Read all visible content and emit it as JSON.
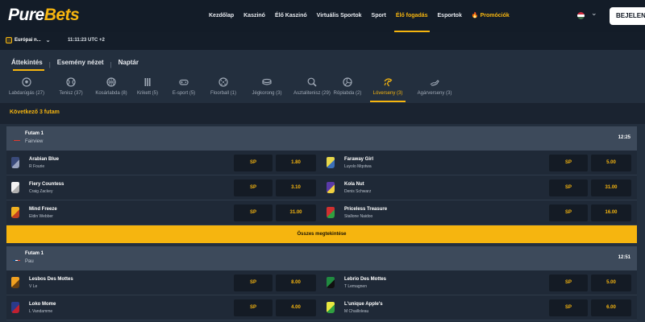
{
  "brand": {
    "logo_main": "Pure",
    "logo_accent": "Bets"
  },
  "nav": {
    "items": [
      {
        "label": "Kezdőlap"
      },
      {
        "label": "Kaszinó"
      },
      {
        "label": "Élő Kaszinó"
      },
      {
        "label": "Virtuális Sportok"
      },
      {
        "label": "Sport"
      },
      {
        "label": "Élő fogadás"
      },
      {
        "label": "Esportok"
      },
      {
        "label": "Promóciók"
      }
    ],
    "active_index": 5,
    "login_label": "BEJELEN"
  },
  "subbar": {
    "odds_format": "Európai n...",
    "clock": "11:11:23 UTC +2"
  },
  "tabs": [
    {
      "label": "Áttekintés"
    },
    {
      "label": "Esemény nézet"
    },
    {
      "label": "Naptár"
    }
  ],
  "sports": [
    {
      "label": "Labdarúgás (27)",
      "icon": "soccer-ball-icon"
    },
    {
      "label": "Tenisz (37)",
      "icon": "tennis-ball-icon"
    },
    {
      "label": "Kosárlabda (8)",
      "icon": "basketball-icon"
    },
    {
      "label": "Krikett (5)",
      "icon": "cricket-icon"
    },
    {
      "label": "E-sport (5)",
      "icon": "gamepad-icon"
    },
    {
      "label": "Floorball (1)",
      "icon": "floorball-icon"
    },
    {
      "label": "Jégkorong (3)",
      "icon": "ice-hockey-icon"
    },
    {
      "label": "Asztalitenisz (29)",
      "icon": "table-tennis-icon"
    },
    {
      "label": "Röplabda (2)",
      "icon": "volleyball-icon"
    },
    {
      "label": "Lóverseny (3)",
      "icon": "horse-racing-icon"
    },
    {
      "label": "Agárverseny (3)",
      "icon": "greyhound-icon"
    }
  ],
  "active_sport_index": 9,
  "next_races_label": "Következő 3 futam",
  "view_all_label": "Összes megtekintése",
  "races": [
    {
      "title": "Futam 1",
      "venue": "Fairview",
      "time": "12:25",
      "flag": "south-africa",
      "runners": [
        {
          "name": "Arabian Blue",
          "jockey": "R Fourie",
          "sp": "SP",
          "odds": "1.80",
          "silk": [
            "#3a4a7a",
            "#9aa4c0"
          ]
        },
        {
          "name": "Faraway Girl",
          "jockey": "Luyolo Mqotwa",
          "sp": "SP",
          "odds": "5.00",
          "silk": [
            "#e8d84a",
            "#3b6fb8"
          ]
        },
        {
          "name": "Fiery Countess",
          "jockey": "Craig Zackey",
          "sp": "SP",
          "odds": "3.10",
          "silk": [
            "#f3f3f3",
            "#b0b0b0"
          ]
        },
        {
          "name": "Kola Nut",
          "jockey": "Denis Schwarz",
          "sp": "SP",
          "odds": "31.00",
          "silk": [
            "#5a3aa8",
            "#f0d040"
          ]
        },
        {
          "name": "Mind Freeze",
          "jockey": "Eldin Webber",
          "sp": "SP",
          "odds": "31.00",
          "silk": [
            "#f0b020",
            "#c04020"
          ]
        },
        {
          "name": "Priceless Treasure",
          "jockey": "Stallone Naidoo",
          "sp": "SP",
          "odds": "16.00",
          "silk": [
            "#d03030",
            "#30a040"
          ]
        }
      ]
    },
    {
      "title": "Futam 1",
      "venue": "Pau",
      "time": "12:51",
      "flag": "france",
      "runners": [
        {
          "name": "Lesbos Des Mottes",
          "jockey": "V Le",
          "sp": "SP",
          "odds": "8.00",
          "silk": [
            "#f0a020",
            "#6a4010"
          ]
        },
        {
          "name": "Lebrio Des Mottes",
          "jockey": "T Lemagnen",
          "sp": "SP",
          "odds": "5.00",
          "silk": [
            "#208a40",
            "#101010"
          ]
        },
        {
          "name": "Loko Mome",
          "jockey": "L Vandamme",
          "sp": "SP",
          "odds": "4.00",
          "silk": [
            "#2a3a8a",
            "#c02030"
          ]
        },
        {
          "name": "L'unique Apple's",
          "jockey": "M Chailloleau",
          "sp": "SP",
          "odds": "6.00",
          "silk": [
            "#e8e840",
            "#30a040"
          ]
        }
      ]
    }
  ],
  "colors": {
    "accent": "#f6b50f",
    "panel": "#232f3e",
    "header": "#3d4a5b",
    "nav_bg": "#131c28"
  }
}
